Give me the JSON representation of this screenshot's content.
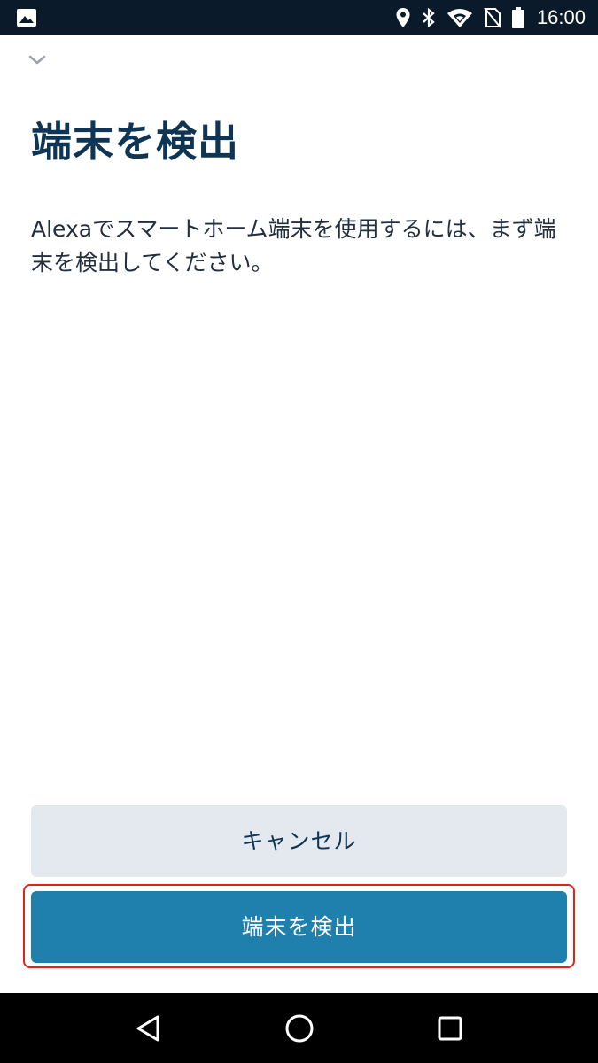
{
  "status_bar": {
    "time": "16:00",
    "icons": [
      "image-icon",
      "location-icon",
      "bluetooth-icon",
      "wifi-icon",
      "no-sim-icon",
      "battery-icon"
    ]
  },
  "header": {
    "collapse_icon": "chevron-down-icon"
  },
  "main": {
    "title": "端末を検出",
    "description": "Alexaでスマートホーム端末を使用するには、まず端末を検出してください。"
  },
  "actions": {
    "cancel_label": "キャンセル",
    "discover_label": "端末を検出"
  },
  "nav_bar": {
    "icons": [
      "back-icon",
      "home-icon",
      "recents-icon"
    ]
  },
  "colors": {
    "title": "#0f3554",
    "primary_button": "#1f7fad",
    "secondary_button": "#e3e9ef",
    "focus_ring": "#e2231a",
    "status_bar": "#0b1a2b"
  }
}
